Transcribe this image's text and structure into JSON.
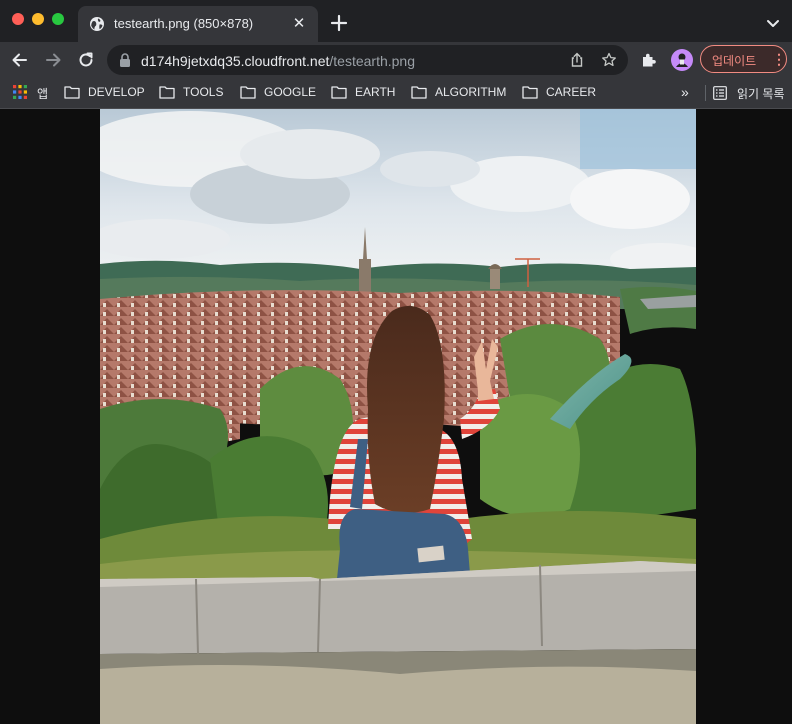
{
  "tab": {
    "title": "testearth.png (850×878)",
    "close_symbol": "✕"
  },
  "toolbar": {
    "url_host": "d174h9jetxdq35.cloudfront.net",
    "url_path": "/testearth.png",
    "update_label": "업데이트",
    "update_menu_symbol": "⋮"
  },
  "bookmarks": {
    "items": [
      {
        "label": "앱",
        "icon": "apps-grid-icon"
      },
      {
        "label": "DEVELOP",
        "icon": "folder-icon"
      },
      {
        "label": "TOOLS",
        "icon": "folder-icon"
      },
      {
        "label": "GOOGLE",
        "icon": "folder-icon"
      },
      {
        "label": "EARTH",
        "icon": "folder-icon"
      },
      {
        "label": "ALGORITHM",
        "icon": "folder-icon"
      },
      {
        "label": "CAREER",
        "icon": "folder-icon"
      }
    ],
    "more_symbol": "»",
    "reading_list_label": "읽기 목록"
  },
  "colors": {
    "tabbar_bg": "#202124",
    "toolbar_bg": "#35363a",
    "update_accent": "#f28b82",
    "profile_avatar": "#c58af9"
  }
}
